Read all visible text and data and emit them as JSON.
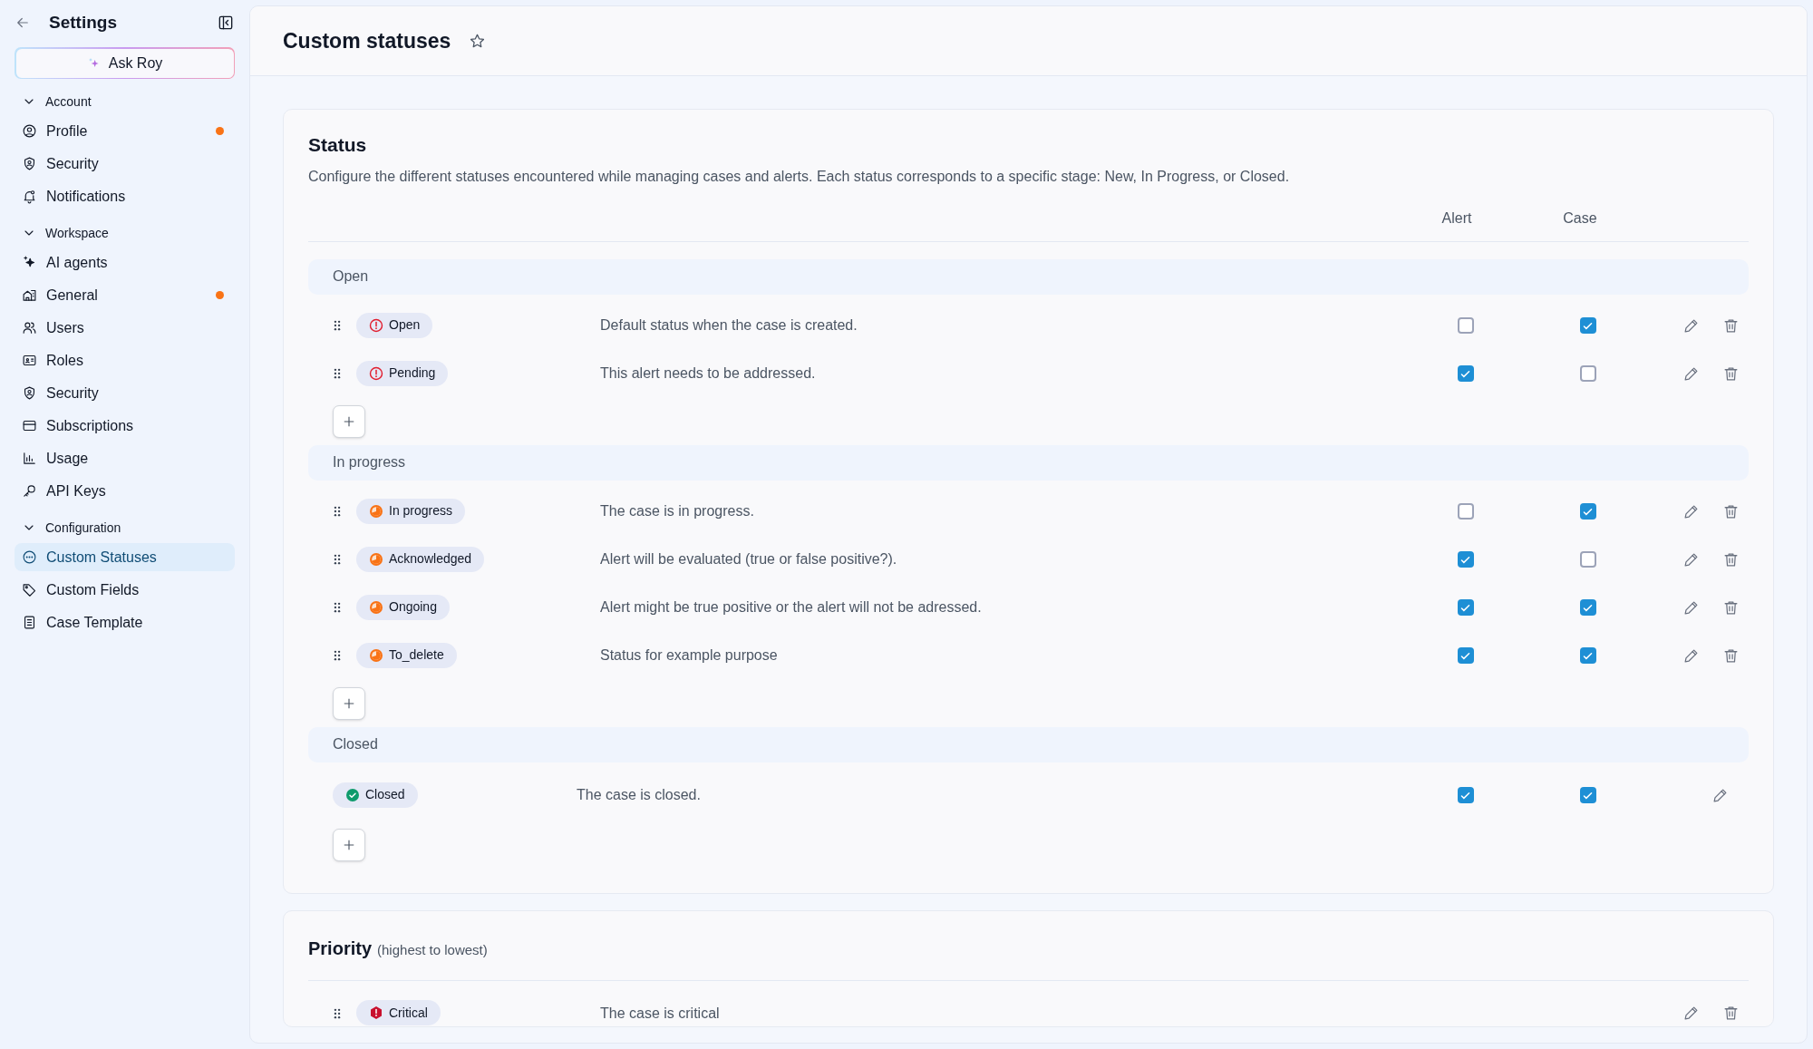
{
  "sidebar": {
    "title": "Settings",
    "ask_button": "Ask Roy",
    "sections": [
      {
        "label": "Account",
        "expanded": true,
        "items": [
          {
            "label": "Profile",
            "badge": true,
            "selected": false
          },
          {
            "label": "Security",
            "badge": false,
            "selected": false
          },
          {
            "label": "Notifications",
            "badge": false,
            "selected": false
          }
        ]
      },
      {
        "label": "Workspace",
        "expanded": true,
        "items": [
          {
            "label": "AI agents",
            "badge": false,
            "selected": false
          },
          {
            "label": "General",
            "badge": true,
            "selected": false
          },
          {
            "label": "Users",
            "badge": false,
            "selected": false
          },
          {
            "label": "Roles",
            "badge": false,
            "selected": false
          },
          {
            "label": "Security",
            "badge": false,
            "selected": false
          },
          {
            "label": "Subscriptions",
            "badge": false,
            "selected": false
          },
          {
            "label": "Usage",
            "badge": false,
            "selected": false
          },
          {
            "label": "API Keys",
            "badge": false,
            "selected": false
          }
        ]
      },
      {
        "label": "Configuration",
        "expanded": true,
        "items": [
          {
            "label": "Custom Statuses",
            "badge": false,
            "selected": true
          },
          {
            "label": "Custom Fields",
            "badge": false,
            "selected": false
          },
          {
            "label": "Case Template",
            "badge": false,
            "selected": false
          }
        ]
      }
    ]
  },
  "page": {
    "title": "Custom statuses",
    "favorite": false
  },
  "status_card": {
    "title": "Status",
    "description": "Configure the different statuses encountered while managing cases and alerts. Each status corresponds to a specific stage: New, In Progress, or Closed.",
    "columns": [
      "Alert",
      "Case"
    ],
    "groups": [
      {
        "label": "Open",
        "statuses": [
          {
            "name": "Open",
            "description": "Default status when the case is created.",
            "alert": false,
            "case": true,
            "locked": false
          },
          {
            "name": "Pending",
            "description": "This alert needs to be addressed.",
            "alert": true,
            "case": false,
            "locked": false
          }
        ]
      },
      {
        "label": "In progress",
        "statuses": [
          {
            "name": "In progress",
            "description": "The case is in progress.",
            "alert": false,
            "case": true,
            "locked": false
          },
          {
            "name": "Acknowledged",
            "description": "Alert will be evaluated (true or false positive?).",
            "alert": true,
            "case": false,
            "locked": false
          },
          {
            "name": "Ongoing",
            "description": "Alert might be true positive or the alert will not be adressed.",
            "alert": true,
            "case": true,
            "locked": false
          },
          {
            "name": "To_delete",
            "description": "Status for example purpose",
            "alert": true,
            "case": true,
            "locked": false
          }
        ]
      },
      {
        "label": "Closed",
        "statuses": [
          {
            "name": "Closed",
            "description": "The case is closed.",
            "alert": true,
            "case": true,
            "locked": true
          }
        ]
      }
    ]
  },
  "priority_card": {
    "title": "Priority",
    "subtitle": "(highest to lowest)",
    "priorities": [
      {
        "name": "Critical",
        "description": "The case is critical"
      }
    ]
  }
}
